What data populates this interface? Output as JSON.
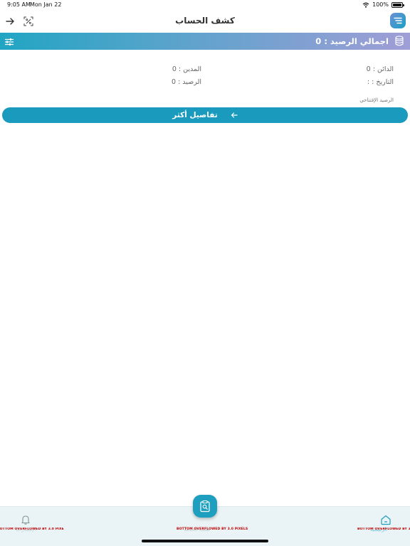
{
  "status": {
    "time": "9:05 AM",
    "date": "Mon Jan 22",
    "battery": "100%"
  },
  "header": {
    "title": "كشف الحساب"
  },
  "banner": {
    "total_balance": "اجمالي الرصيد : 0"
  },
  "summary": {
    "credit": "الدائن : 0",
    "debit": "المدين : 0",
    "date": "التاريخ : :",
    "balance": "الرصيد : 0",
    "opening_balance": "الرصيد الإفتتاحي"
  },
  "details_button": {
    "label": "تفاصيل أكثر"
  },
  "bottom_nav": {
    "left_label": "الإشعارات",
    "center_label": "طلب الخدمة",
    "right_label": "الرئيسية",
    "overflow_warning": "BOTTOM OVERFLOWED BY 3.0 PIXELS"
  },
  "colors": {
    "accent": "#1a9bbd",
    "banner_start": "#21a5c3",
    "banner_end": "#a09ed6",
    "nav_background": "#eaf3f5",
    "warning": "#c00000"
  }
}
